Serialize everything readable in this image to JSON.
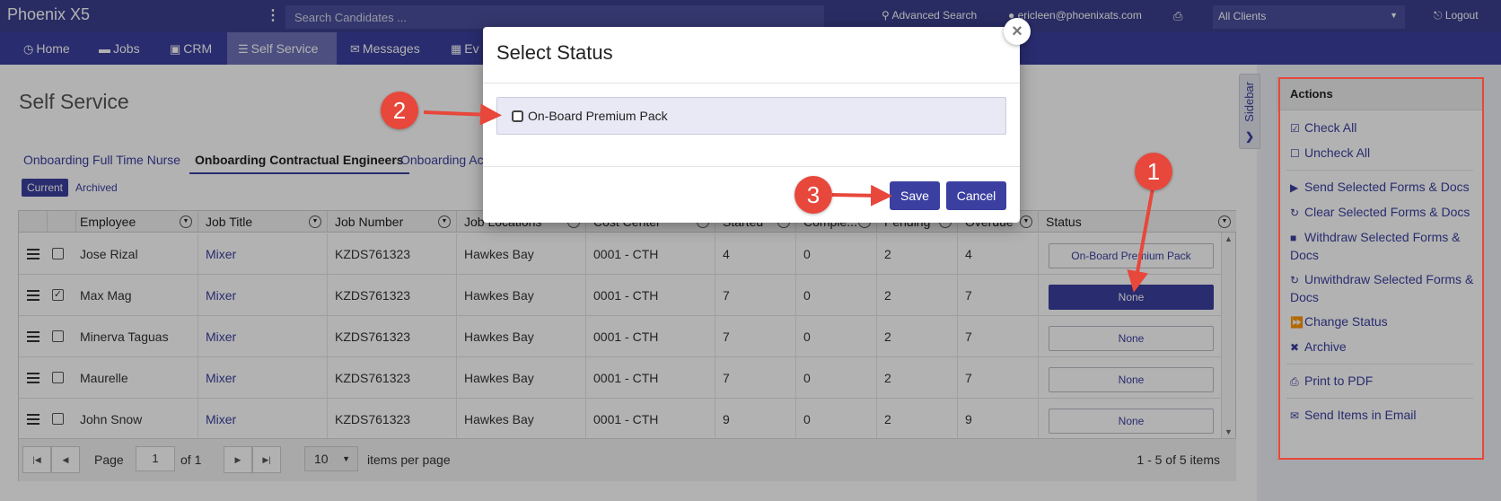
{
  "app": {
    "brand": "Phoenix X5",
    "search_placeholder": "Search Candidates ...",
    "advanced_search": "Advanced Search",
    "user_email": "ericleen@phoenixats.com",
    "client_select": "All Clients",
    "logout": "Logout"
  },
  "nav": [
    {
      "label": "Home",
      "icon": "clock-icon",
      "glyph": "◷"
    },
    {
      "label": "Jobs",
      "icon": "folder-icon",
      "glyph": "▬"
    },
    {
      "label": "CRM",
      "icon": "briefcase-icon",
      "glyph": "▣"
    },
    {
      "label": "Self Service",
      "icon": "list-icon",
      "glyph": "☰"
    },
    {
      "label": "Messages",
      "icon": "envelope-icon",
      "glyph": "✉"
    },
    {
      "label": "Ev",
      "icon": "calendar-icon",
      "glyph": "▦"
    }
  ],
  "page": {
    "title": "Self Service",
    "tabs": [
      "Onboarding Full Time Nurse",
      "Onboarding Contractual Engineers",
      "Onboarding Ac"
    ],
    "filters": [
      "Current",
      "Archived"
    ]
  },
  "grid": {
    "columns": [
      "",
      "",
      "Employee",
      "Job Title",
      "Job Number",
      "Job Locations",
      "Cost Center",
      "Started",
      "Comple...",
      "Pending",
      "Overdue",
      "Status"
    ],
    "rows": [
      {
        "employee": "Jose Rizal",
        "job_title": "Mixer",
        "job_number": "KZDS761323",
        "location": "Hawkes Bay",
        "cost_center": "0001 - CTH",
        "started": "4",
        "completed": "0",
        "pending": "2",
        "overdue": "4",
        "status": "On-Board Premium Pack",
        "checked": false,
        "selected": false
      },
      {
        "employee": "Max Mag",
        "job_title": "Mixer",
        "job_number": "KZDS761323",
        "location": "Hawkes Bay",
        "cost_center": "0001 - CTH",
        "started": "7",
        "completed": "0",
        "pending": "2",
        "overdue": "7",
        "status": "None",
        "checked": true,
        "selected": true
      },
      {
        "employee": "Minerva Taguas",
        "job_title": "Mixer",
        "job_number": "KZDS761323",
        "location": "Hawkes Bay",
        "cost_center": "0001 - CTH",
        "started": "7",
        "completed": "0",
        "pending": "2",
        "overdue": "7",
        "status": "None",
        "checked": false,
        "selected": false
      },
      {
        "employee": "Maurelle",
        "job_title": "Mixer",
        "job_number": "KZDS761323",
        "location": "Hawkes Bay",
        "cost_center": "0001 - CTH",
        "started": "7",
        "completed": "0",
        "pending": "2",
        "overdue": "7",
        "status": "None",
        "checked": false,
        "selected": false
      },
      {
        "employee": "John Snow",
        "job_title": "Mixer",
        "job_number": "KZDS761323",
        "location": "Hawkes Bay",
        "cost_center": "0001 - CTH",
        "started": "9",
        "completed": "0",
        "pending": "2",
        "overdue": "9",
        "status": "None",
        "checked": false,
        "selected": false
      }
    ],
    "pager": {
      "page_label": "Page",
      "page": "1",
      "of_label": "of 1",
      "page_size": "10",
      "items_label": "items per page",
      "info": "1 - 5 of 5 items"
    }
  },
  "sidebar": {
    "tab_label": "Sidebar",
    "actions_title": "Actions",
    "actions": [
      {
        "label": "Check All",
        "icon": "check-square-icon",
        "glyph": "☑"
      },
      {
        "label": "Uncheck All",
        "icon": "square-icon",
        "glyph": "☐"
      },
      {
        "label": "Send Selected Forms & Docs",
        "icon": "play-icon",
        "glyph": "▶"
      },
      {
        "label": "Clear Selected Forms & Docs",
        "icon": "refresh-icon",
        "glyph": "↻"
      },
      {
        "label": "Withdraw Selected Forms & Docs",
        "icon": "stop-icon",
        "glyph": "■"
      },
      {
        "label": "Unwithdraw Selected Forms & Docs",
        "icon": "refresh-icon",
        "glyph": "↻"
      },
      {
        "label": "Change Status",
        "icon": "fast-forward-icon",
        "glyph": "⏩"
      },
      {
        "label": "Archive",
        "icon": "x-icon",
        "glyph": "✖"
      },
      {
        "label": "Print to PDF",
        "icon": "print-icon",
        "glyph": "⎙"
      },
      {
        "label": "Send Items in Email",
        "icon": "envelope-icon",
        "glyph": "✉"
      }
    ]
  },
  "modal": {
    "title": "Select Status",
    "option": "On-Board Premium Pack",
    "save": "Save",
    "cancel": "Cancel",
    "close": "×"
  },
  "annotations": {
    "badge_color": "#e8473b",
    "badges": [
      "1",
      "2",
      "3"
    ]
  }
}
